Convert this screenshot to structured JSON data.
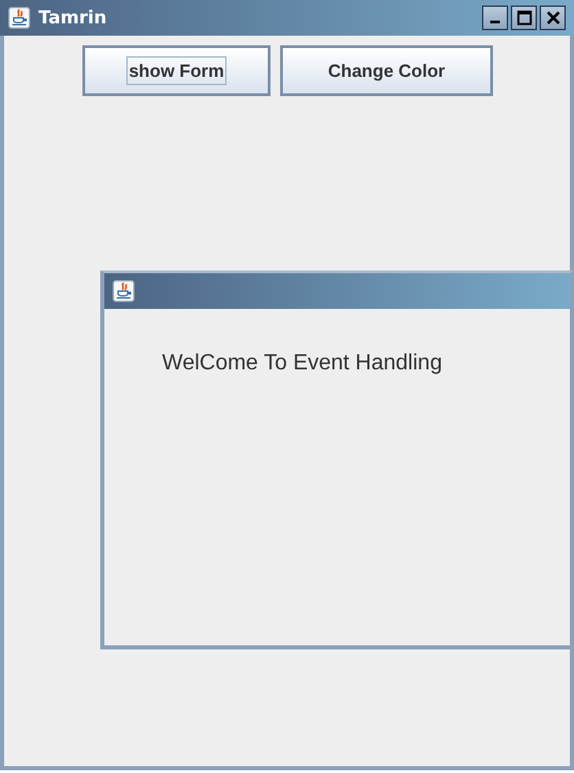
{
  "window": {
    "title": "Tamrin"
  },
  "buttons": [
    {
      "label": "show Form",
      "focused": true
    },
    {
      "label": "Change Color",
      "focused": false
    }
  ],
  "internal_frame": {
    "message": "WelCome To Event Handling"
  }
}
